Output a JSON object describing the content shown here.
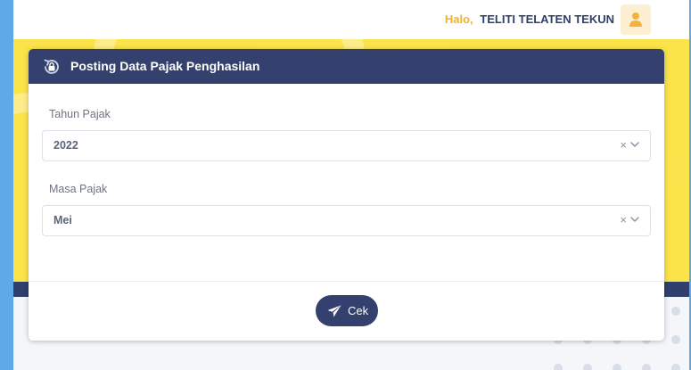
{
  "topbar": {
    "greeting_prefix": "Halo,",
    "user_name": "TELITI TELATEN TEKUN",
    "avatar_icon": "user-icon"
  },
  "card": {
    "title": "Posting Data Pajak Penghasilan",
    "header_icon": "lock-refresh-icon",
    "fields": [
      {
        "label": "Tahun Pajak",
        "value": "2022"
      },
      {
        "label": "Masa Pajak",
        "value": "Mei"
      }
    ],
    "clear_symbol": "×",
    "submit_label": "Cek",
    "submit_icon": "send-icon"
  },
  "colors": {
    "primary": "#34406d",
    "accent": "#f0b429",
    "banner": "#fbe34a"
  }
}
